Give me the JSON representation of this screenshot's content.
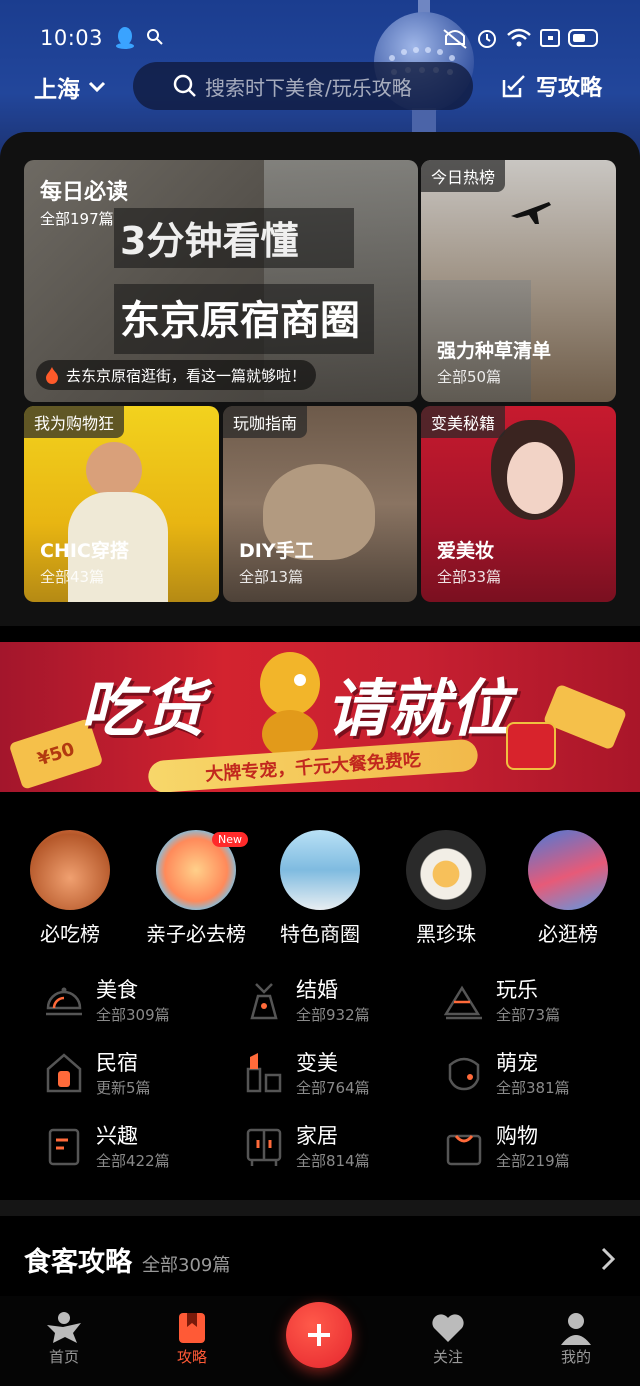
{
  "status_bar": {
    "time": "10:03"
  },
  "header": {
    "city": "上海",
    "search_placeholder": "搜索时下美食/玩乐攻略",
    "write_label": "写攻略"
  },
  "featured": {
    "daily": {
      "title": "每日必读",
      "count": "全部197篇",
      "overlay_line1": "3分钟看懂",
      "overlay_line2": "东京原宿商圈",
      "caption": "去东京原宿逛街，看这一篇就够啦！"
    },
    "hot": {
      "tag": "今日热榜",
      "title": "强力种草清单",
      "count": "全部50篇"
    },
    "cards": [
      {
        "tag": "我为购物狂",
        "title": "CHIC穿搭",
        "count": "全部43篇"
      },
      {
        "tag": "玩咖指南",
        "title": "DIY手工",
        "count": "全部13篇"
      },
      {
        "tag": "变美秘籍",
        "title": "爱美妆",
        "count": "全部33篇"
      }
    ]
  },
  "banner": {
    "headline_left": "吃货",
    "headline_right": "请就位",
    "sub": "大牌专宠，千元大餐免费吃",
    "coupon": "¥50"
  },
  "quick_links": [
    {
      "label": "必吃榜"
    },
    {
      "label": "亲子必去榜",
      "badge": "New"
    },
    {
      "label": "特色商圈"
    },
    {
      "label": "黑珍珠"
    },
    {
      "label": "必逛榜"
    }
  ],
  "categories": [
    {
      "name": "美食",
      "count": "全部309篇",
      "icon": "dome-icon"
    },
    {
      "name": "结婚",
      "count": "全部932篇",
      "icon": "wedding-icon"
    },
    {
      "name": "玩乐",
      "count": "全部73篇",
      "icon": "mountain-icon"
    },
    {
      "name": "民宿",
      "count": "更新5篇",
      "icon": "house-icon"
    },
    {
      "name": "变美",
      "count": "全部764篇",
      "icon": "lipstick-icon"
    },
    {
      "name": "萌宠",
      "count": "全部381篇",
      "icon": "dog-icon"
    },
    {
      "name": "兴趣",
      "count": "全部422篇",
      "icon": "book-icon"
    },
    {
      "name": "家居",
      "count": "全部814篇",
      "icon": "cabinet-icon"
    },
    {
      "name": "购物",
      "count": "全部219篇",
      "icon": "bag-icon"
    }
  ],
  "section": {
    "title": "食客攻略",
    "count": "全部309篇"
  },
  "tabs": [
    {
      "label": "首页"
    },
    {
      "label": "攻略"
    },
    {
      "label": "关注"
    },
    {
      "label": "我的"
    }
  ],
  "colors": {
    "accent": "#ff5a36",
    "background": "#000000",
    "header_blue": "#22469b"
  }
}
